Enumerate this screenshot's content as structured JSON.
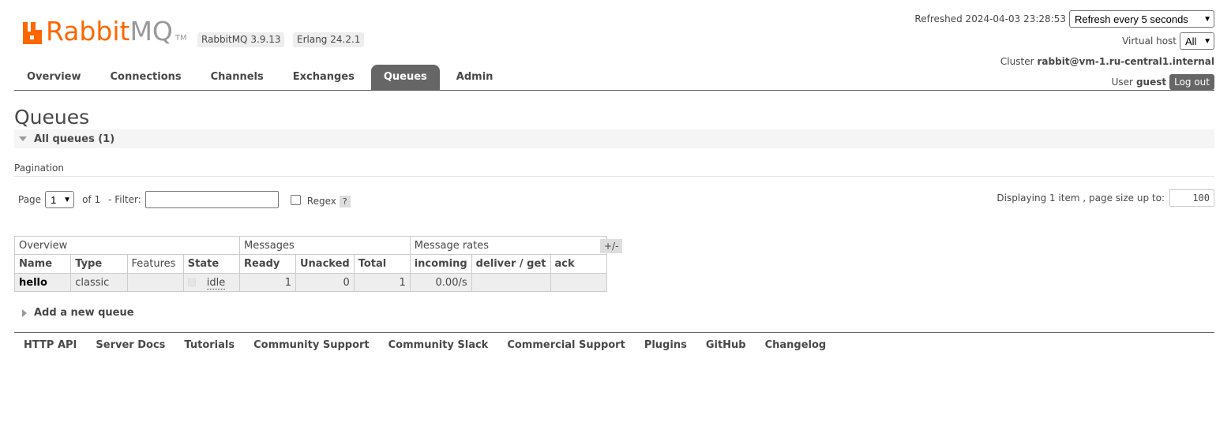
{
  "header": {
    "logo_brand": "Rabbit",
    "logo_mq": "MQ",
    "logo_tm": "TM",
    "brand_color": "#ff6600",
    "rabbitmq_version": "RabbitMQ 3.9.13",
    "erlang_version": "Erlang 24.2.1",
    "refreshed_label": "Refreshed 2024-04-03 23:28:53",
    "refresh_select": "Refresh every 5 seconds",
    "virtual_host_label": "Virtual host",
    "virtual_host_select": "All",
    "cluster_label": "Cluster",
    "cluster_name": "rabbit@vm-1.ru-central1.internal",
    "user_label": "User",
    "user_name": "guest",
    "logout_label": "Log out"
  },
  "tabs": [
    {
      "label": "Overview",
      "active": false
    },
    {
      "label": "Connections",
      "active": false
    },
    {
      "label": "Channels",
      "active": false
    },
    {
      "label": "Exchanges",
      "active": false
    },
    {
      "label": "Queues",
      "active": true
    },
    {
      "label": "Admin",
      "active": false
    }
  ],
  "main": {
    "title": "Queues",
    "section_label": "All queues (1)",
    "pagination_label": "Pagination",
    "page_label": "Page",
    "page_select": "1",
    "of_label": "of 1",
    "filter_label": "- Filter:",
    "filter_value": "",
    "regex_label": "Regex",
    "regex_help": "?",
    "regex_checked": false,
    "displaying_label": "Displaying 1 item , page size up to:",
    "page_size": "100",
    "columns_toggle": "+/-",
    "add_queue_label": "Add a new queue"
  },
  "table": {
    "groups": [
      "Overview",
      "Messages",
      "Message rates"
    ],
    "columns": [
      "Name",
      "Type",
      "Features",
      "State",
      "Ready",
      "Unacked",
      "Total",
      "incoming",
      "deliver / get",
      "ack"
    ],
    "rows": [
      {
        "name": "hello",
        "type": "classic",
        "features": "",
        "state": "idle",
        "ready": "1",
        "unacked": "0",
        "total": "1",
        "incoming": "0.00/s",
        "deliver_get": "",
        "ack": ""
      }
    ]
  },
  "footer": {
    "links": [
      "HTTP API",
      "Server Docs",
      "Tutorials",
      "Community Support",
      "Community Slack",
      "Commercial Support",
      "Plugins",
      "GitHub",
      "Changelog"
    ]
  }
}
